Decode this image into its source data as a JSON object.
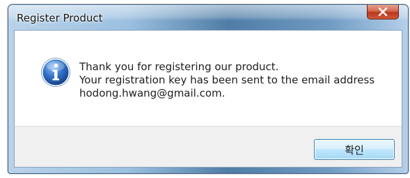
{
  "window": {
    "title": "Register Product"
  },
  "message": {
    "line1": "Thank you for registering our product.",
    "line2": "Your registration key has been sent to the email address",
    "line3": "hodong.hwang@gmail.com."
  },
  "buttons": {
    "ok_label": "확인"
  },
  "icons": {
    "message_icon": "information-icon",
    "close_icon": "close-icon"
  },
  "colors": {
    "title_bar": "#4f7da6",
    "close_button": "#c7472a",
    "ok_button_border": "#3c7fb1",
    "footer_background": "#f0f0f0"
  }
}
